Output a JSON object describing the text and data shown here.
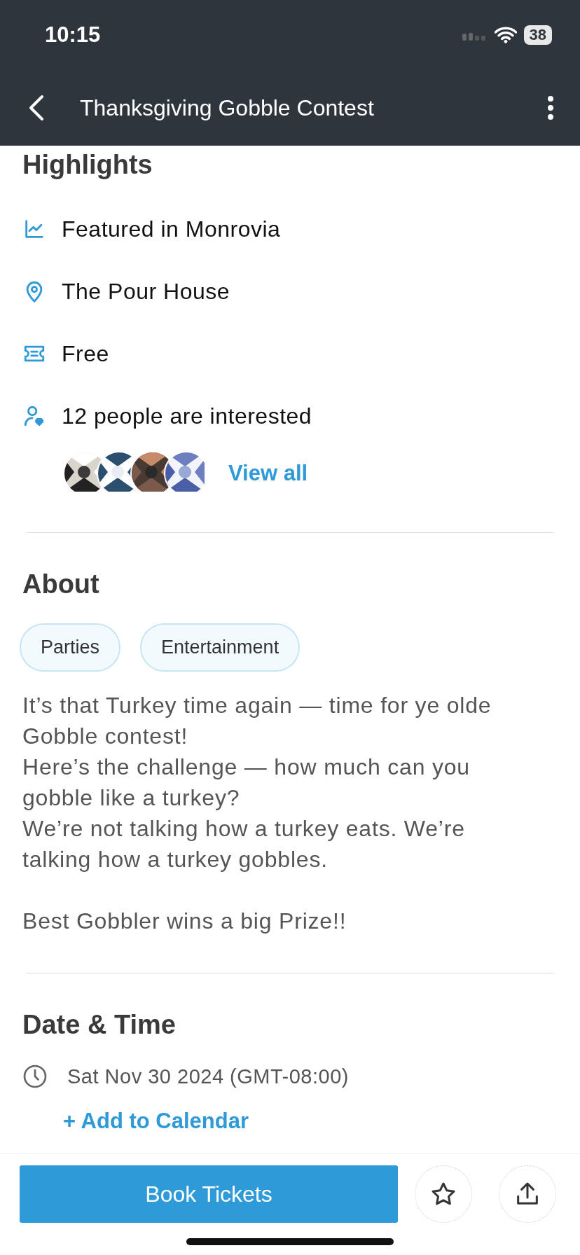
{
  "status_bar": {
    "time": "10:15",
    "battery": "38"
  },
  "nav": {
    "title": "Thanksgiving Gobble Contest"
  },
  "highlights": {
    "title": "Highlights",
    "items": [
      {
        "kind": "featured",
        "text": "Featured in Monrovia"
      },
      {
        "kind": "location",
        "text": "The Pour House"
      },
      {
        "kind": "ticket",
        "text": "Free"
      },
      {
        "kind": "interested",
        "text": "12 people are interested"
      }
    ],
    "view_all": "View all"
  },
  "about": {
    "title": "About",
    "tags": [
      "Parties",
      "Entertainment"
    ],
    "paragraphs": [
      [
        "It’s that Turkey time again — time for ye olde Gobble contest!",
        "Here’s the challenge — how much can you gobble like a turkey?",
        "We’re not talking how a turkey eats. We’re talking how a turkey gobbles."
      ],
      [
        "Best Gobbler wins a big Prize!!"
      ]
    ]
  },
  "date_time": {
    "title": "Date & Time",
    "date": "Sat Nov 30 2024 (GMT-08:00)",
    "add_to_calendar": "+ Add to Calendar"
  },
  "bottom_bar": {
    "button": "Book Tickets"
  }
}
